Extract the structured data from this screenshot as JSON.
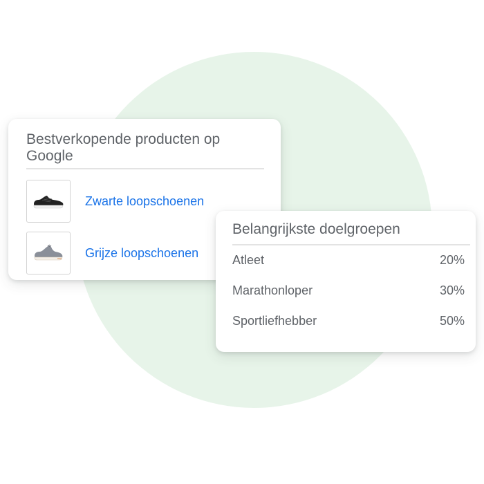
{
  "products_card": {
    "title": "Bestverkopende producten op Google",
    "items": [
      {
        "label": "Zwarte loopschoenen",
        "icon": "black-running-shoe-icon",
        "color": "#222222"
      },
      {
        "label": "Grijze loopschoenen",
        "icon": "grey-running-shoe-icon",
        "color": "#8a8f99"
      }
    ]
  },
  "audience_card": {
    "title": "Belangrijkste doelgroepen",
    "rows": [
      {
        "label": "Atleet",
        "value": "20%"
      },
      {
        "label": "Marathonloper",
        "value": "30%"
      },
      {
        "label": "Sportliefhebber",
        "value": "50%"
      }
    ]
  },
  "colors": {
    "link": "#1a73e8",
    "text": "#5f6368",
    "circle": "#e7f4e9"
  }
}
